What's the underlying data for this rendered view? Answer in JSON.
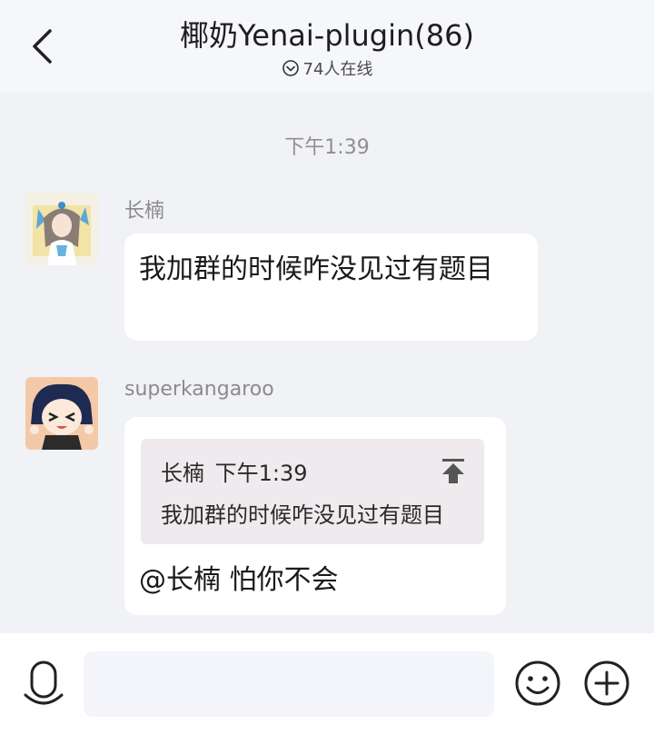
{
  "header": {
    "title": "椰奶Yenai-plugin(86)",
    "online_text": "74人在线",
    "back_icon": "chevron-left-icon"
  },
  "chat": {
    "timestamp": "下午1:39",
    "messages": [
      {
        "sender": "长楠",
        "avatar": "anime-girl-avatar",
        "text": "我加群的时候咋没见过有题目"
      },
      {
        "sender": "superkangaroo",
        "avatar": "chibi-character-avatar",
        "quote": {
          "author": "长楠",
          "time": "下午1:39",
          "text": "我加群的时候咋没见过有题目"
        },
        "text": "@长楠 怕你不会"
      }
    ]
  },
  "footer": {
    "input_placeholder": "",
    "icons": [
      "microphone-icon",
      "emoji-icon",
      "plus-icon"
    ]
  }
}
